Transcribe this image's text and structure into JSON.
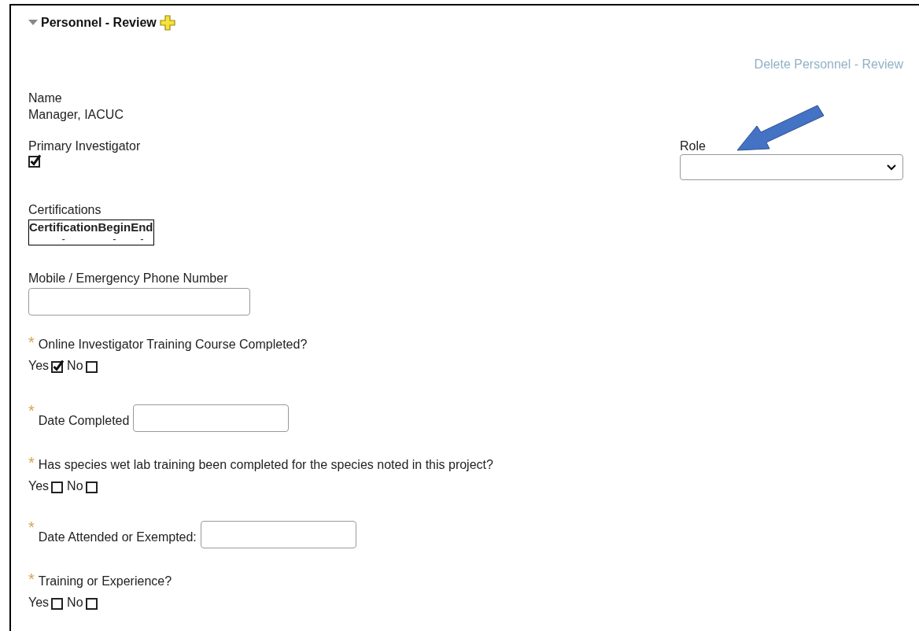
{
  "section": {
    "title": "Personnel - Review",
    "expanded": true
  },
  "delete_link": "Delete Personnel - Review",
  "name": {
    "label": "Name",
    "value": "Manager, IACUC"
  },
  "primary_investigator": {
    "label": "Primary Investigator",
    "checked": true
  },
  "role": {
    "label": "Role"
  },
  "certifications": {
    "label": "Certifications",
    "columns": [
      "Certification",
      "Begin",
      "End"
    ],
    "rows": [
      [
        "-",
        "-",
        "-"
      ]
    ]
  },
  "phone": {
    "label": "Mobile / Emergency Phone Number"
  },
  "questions": [
    {
      "kind": "yesno",
      "required_mark": "*",
      "label": "Online Investigator Training Course Completed?",
      "options": [
        {
          "label": "Yes",
          "checked": true
        },
        {
          "label": "No",
          "checked": false
        }
      ]
    },
    {
      "kind": "date",
      "required_mark": "*",
      "label": "Date Completed"
    },
    {
      "kind": "yesno",
      "required_mark": "*",
      "label": "Has species wet lab training been completed for the species noted in this project?",
      "options": [
        {
          "label": "Yes",
          "checked": false
        },
        {
          "label": "No",
          "checked": false
        }
      ]
    },
    {
      "kind": "date",
      "required_mark": "*",
      "label": "Date Attended or Exempted:"
    },
    {
      "kind": "yesno",
      "required_mark": "*",
      "label": "Training or Experience?",
      "options": [
        {
          "label": "Yes",
          "checked": false
        },
        {
          "label": "No",
          "checked": false
        }
      ]
    }
  ]
}
